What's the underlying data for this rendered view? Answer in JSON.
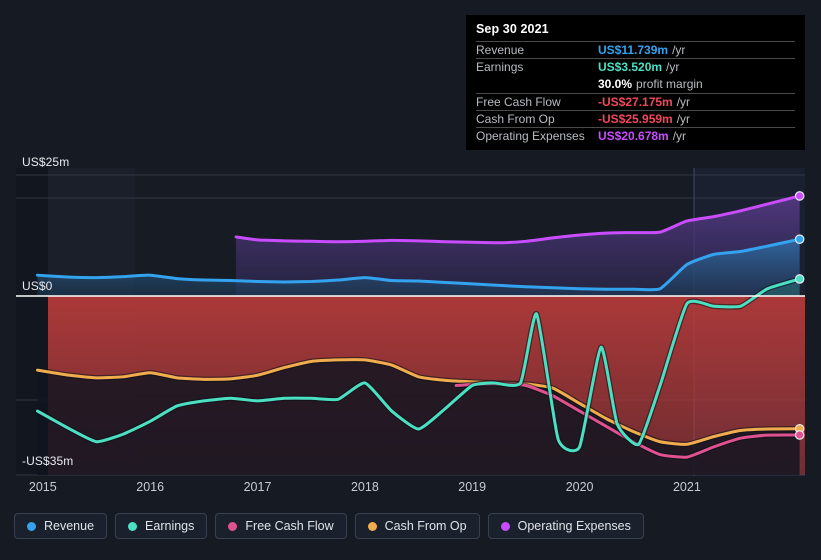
{
  "tooltip": {
    "title": "Sep 30 2021",
    "rows": [
      {
        "name": "Revenue",
        "value": "US$11.739m",
        "unit": "/yr",
        "color": "#33a3ef"
      },
      {
        "name": "Earnings",
        "value": "US$3.520m",
        "unit": "/yr",
        "color": "#4ce0c3"
      },
      {
        "name": "",
        "value": "30.0%",
        "unit": "profit margin",
        "color": "#ffffff",
        "no_rule": true
      },
      {
        "name": "Free Cash Flow",
        "value": "-US$27.175m",
        "unit": "/yr",
        "color": "#f2495c"
      },
      {
        "name": "Cash From Op",
        "value": "-US$25.959m",
        "unit": "/yr",
        "color": "#f2495c"
      },
      {
        "name": "Operating Expenses",
        "value": "US$20.678m",
        "unit": "/yr",
        "color": "#c94dff"
      }
    ]
  },
  "legend": {
    "items": [
      {
        "label": "Revenue",
        "color": "#33a3ef"
      },
      {
        "label": "Earnings",
        "color": "#4ce0c3"
      },
      {
        "label": "Free Cash Flow",
        "color": "#e0518f"
      },
      {
        "label": "Cash From Op",
        "color": "#f0ad4e"
      },
      {
        "label": "Operating Expenses",
        "color": "#c94dff"
      }
    ]
  },
  "chart_data": {
    "type": "line",
    "title": "",
    "xlabel": "",
    "ylabel": "",
    "grid": true,
    "legend_position": "bottom",
    "ylim": [
      -35,
      25
    ],
    "y_ticks": [
      {
        "label": "US$25m",
        "value": 25
      },
      {
        "label": "US$0",
        "value": 0
      },
      {
        "label": "-US$35m",
        "value": -35
      }
    ],
    "x_ticks": [
      "2015",
      "2016",
      "2017",
      "2018",
      "2019",
      "2020",
      "2021"
    ],
    "x_range": [
      2014.75,
      2022.1
    ],
    "currency": "US$",
    "units": "m",
    "series": [
      {
        "name": "Revenue",
        "color": "#33a3ef",
        "fill": "#17405f",
        "x": [
          2014.95,
          2015.25,
          2015.5,
          2015.75,
          2016.0,
          2016.25,
          2016.5,
          2016.75,
          2017.0,
          2017.25,
          2017.5,
          2017.75,
          2018.0,
          2018.25,
          2018.5,
          2018.75,
          2019.0,
          2019.25,
          2019.5,
          2019.75,
          2020.0,
          2020.25,
          2020.5,
          2020.75,
          2021.0,
          2021.25,
          2021.5,
          2021.75,
          2022.05
        ],
        "y": [
          4.3,
          3.9,
          3.8,
          4.0,
          4.3,
          3.6,
          3.3,
          3.2,
          3.0,
          2.9,
          3.0,
          3.3,
          3.8,
          3.2,
          3.1,
          2.8,
          2.5,
          2.2,
          1.9,
          1.7,
          1.5,
          1.4,
          1.4,
          1.5,
          6.5,
          8.6,
          9.2,
          10.3,
          11.739
        ]
      },
      {
        "name": "Earnings",
        "color": "#4ce0c3",
        "fill": "#1b3f42",
        "x": [
          2014.95,
          2015.25,
          2015.5,
          2015.75,
          2016.0,
          2016.25,
          2016.5,
          2016.75,
          2017.0,
          2017.25,
          2017.5,
          2017.75,
          2018.0,
          2018.25,
          2018.5,
          2018.75,
          2019.0,
          2019.2,
          2019.45,
          2019.6,
          2019.8,
          2020.0,
          2020.2,
          2020.35,
          2020.55,
          2020.75,
          2021.0,
          2021.25,
          2021.5,
          2021.75,
          2022.05
        ],
        "y": [
          -22.5,
          -26.0,
          -28.5,
          -27.0,
          -24.5,
          -21.5,
          -20.5,
          -20.0,
          -20.5,
          -20.0,
          -20.0,
          -20.2,
          -17.0,
          -22.5,
          -26.0,
          -22.0,
          -17.5,
          -17.0,
          -17.0,
          -3.5,
          -28.0,
          -29.5,
          -10.0,
          -25.0,
          -29.0,
          -17.5,
          -1.5,
          -2.0,
          -2.0,
          1.5,
          3.52
        ]
      },
      {
        "name": "Free Cash Flow",
        "color": "#e0518f",
        "fill": "",
        "x": [
          2018.85,
          2019.0,
          2019.25,
          2019.5,
          2019.75,
          2020.0,
          2020.25,
          2020.5,
          2020.75,
          2021.0,
          2021.25,
          2021.5,
          2021.75,
          2022.05
        ],
        "y": [
          -17.5,
          -17.3,
          -17.2,
          -17.5,
          -19.5,
          -22.5,
          -25.5,
          -28.5,
          -31.0,
          -31.5,
          -29.5,
          -27.8,
          -27.2,
          -27.175
        ]
      },
      {
        "name": "Cash From Op",
        "color": "#f0ad4e",
        "fill": "",
        "x": [
          2014.95,
          2015.25,
          2015.5,
          2015.75,
          2016.0,
          2016.25,
          2016.5,
          2016.75,
          2017.0,
          2017.25,
          2017.5,
          2017.75,
          2018.0,
          2018.25,
          2018.5,
          2018.75,
          2019.0,
          2019.25,
          2019.5,
          2019.75,
          2020.0,
          2020.25,
          2020.5,
          2020.75,
          2021.0,
          2021.25,
          2021.5,
          2021.75,
          2022.05
        ],
        "y": [
          -14.5,
          -15.5,
          -16.0,
          -15.8,
          -15.0,
          -16.0,
          -16.3,
          -16.2,
          -15.5,
          -14.0,
          -12.8,
          -12.5,
          -12.5,
          -13.5,
          -15.8,
          -16.5,
          -16.8,
          -17.0,
          -17.2,
          -18.0,
          -21.0,
          -24.0,
          -26.5,
          -28.5,
          -29.0,
          -27.5,
          -26.3,
          -26.0,
          -25.959
        ]
      },
      {
        "name": "Operating Expenses",
        "color": "#c94dff",
        "fill": "#3c2a66",
        "x": [
          2016.8,
          2017.0,
          2017.25,
          2017.5,
          2017.75,
          2018.0,
          2018.25,
          2018.5,
          2018.75,
          2019.0,
          2019.25,
          2019.5,
          2019.75,
          2020.0,
          2020.25,
          2020.5,
          2020.75,
          2021.0,
          2021.25,
          2021.5,
          2021.75,
          2022.05
        ],
        "y": [
          12.2,
          11.6,
          11.4,
          11.3,
          11.2,
          11.3,
          11.5,
          11.4,
          11.2,
          11.1,
          11.0,
          11.3,
          12.0,
          12.6,
          13.0,
          13.1,
          13.2,
          15.5,
          16.4,
          17.6,
          19.0,
          20.678
        ]
      }
    ]
  }
}
